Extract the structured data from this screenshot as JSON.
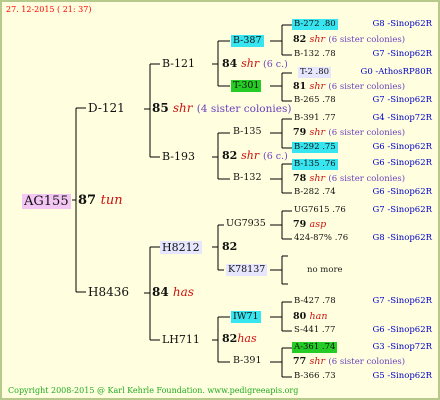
{
  "date": "27. 12-2015 ( 21: 37)",
  "footer": "Copyright 2008-2015 @ Karl Kehrle Foundation.   www.pedigreeapis.org",
  "colors": {
    "background": "#ffffdf",
    "border": "#b8c98c",
    "red": "#cc1111",
    "blue": "#0000cc",
    "cyan": "#37e5f0",
    "green": "#26cc26",
    "magenta": "#f3c6f3"
  },
  "root": {
    "name": "AG155",
    "number": "87",
    "race": "tun"
  },
  "dam": {
    "name": "D-121",
    "number": "85",
    "race": "shr",
    "note": "(4 sister colonies)"
  },
  "sire": {
    "name": "H8436",
    "number": "84",
    "race": "has"
  },
  "gen3": [
    {
      "name": "B-121",
      "number": "84",
      "race": "shr",
      "note": "(6 c.)"
    },
    {
      "name": "B-193",
      "number": "82",
      "race": "shr",
      "note": "(6 c.)"
    },
    {
      "name": "H8212",
      "number": "82"
    },
    {
      "name": "LH711",
      "number": "82",
      "race": "has"
    }
  ],
  "gen2": [
    "B-387",
    "T-301",
    "B-135",
    "B-132",
    "UG7935",
    "K78137",
    "IW71",
    "B-391"
  ],
  "gen2_details": [
    {
      "number": "82",
      "race": "shr",
      "note": "(6 sister colonies)"
    },
    {
      "number": "81",
      "race": "shr",
      "note": "(6 sister colonies)"
    },
    {
      "number": "79",
      "race": "shr",
      "note": "(6 sister colonies)"
    },
    {
      "number": "78",
      "race": "shr",
      "note": "(6 sister colonies)"
    },
    {
      "number": "79",
      "race": "asp"
    },
    {
      "text": "no more"
    },
    {
      "number": "80",
      "race": "han"
    },
    {
      "number": "77",
      "race": "shr",
      "note": "(6 sister colonies)"
    }
  ],
  "gen1": [
    {
      "name": "B-272 .80",
      "src": "G8 -Sinop62R"
    },
    {
      "name": "B-132 .78",
      "src": "G7 -Sinop62R"
    },
    {
      "name": "T-2 .80",
      "src": "G0 -AthosRP80R"
    },
    {
      "name": "B-265 .78",
      "src": "G7 -Sinop62R"
    },
    {
      "name": "B-391 .77",
      "src": "G4 -Sinop72R"
    },
    {
      "name": "B-292 .75",
      "src": "G6 -Sinop62R"
    },
    {
      "name": "B-135 .76",
      "src": "G6 -Sinop62R"
    },
    {
      "name": "B-282 .74",
      "src": "G6 -Sinop62R"
    },
    {
      "name": "UG7615 .76",
      "src": "G7 -Sinop62R"
    },
    {
      "name": "424-87% .76",
      "src": "G8 -Sinop62R"
    },
    {
      "name": "B-427 .78",
      "src": "G7 -Sinop62R"
    },
    {
      "name": "S-441 .77",
      "src": "G6 -Sinop62R"
    },
    {
      "name": "A-361 .74",
      "src": "G3 -Sinop72R"
    },
    {
      "name": "B-366 .73",
      "src": "G5 -Sinop62R"
    }
  ]
}
